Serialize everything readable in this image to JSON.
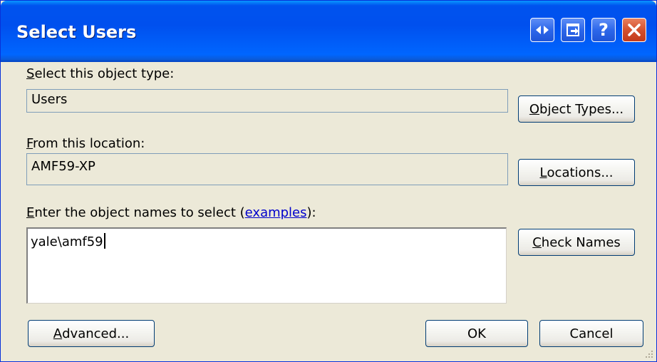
{
  "window": {
    "title": "Select Users",
    "controls": {
      "icon_1": "resize-arrows-icon",
      "icon_2": "window-arrow-icon",
      "help_glyph": "?",
      "close_icon": "close-icon"
    }
  },
  "object_type": {
    "label_mnemonic": "S",
    "label_rest": "elect this object type:",
    "value": "Users",
    "button_mnemonic": "O",
    "button_rest": "bject Types..."
  },
  "location": {
    "label_mnemonic": "F",
    "label_rest": "rom this location:",
    "value": "AMF59-XP",
    "button_mnemonic": "L",
    "button_rest": "ocations..."
  },
  "names": {
    "label_mnemonic": "E",
    "label_rest": "nter the object names to select (",
    "link_text": "examples",
    "label_suffix": "):",
    "value": "yale\\amf59",
    "button_mnemonic": "C",
    "button_rest": "heck Names"
  },
  "footer": {
    "advanced_mnemonic": "A",
    "advanced_rest": "dvanced...",
    "ok_label": "OK",
    "cancel_label": "Cancel"
  },
  "colors": {
    "titlebar": "#0053ee",
    "dialog_bg": "#ece9d8",
    "button_border": "#003c74",
    "close_button": "#d4512e",
    "link": "#0000cc"
  }
}
